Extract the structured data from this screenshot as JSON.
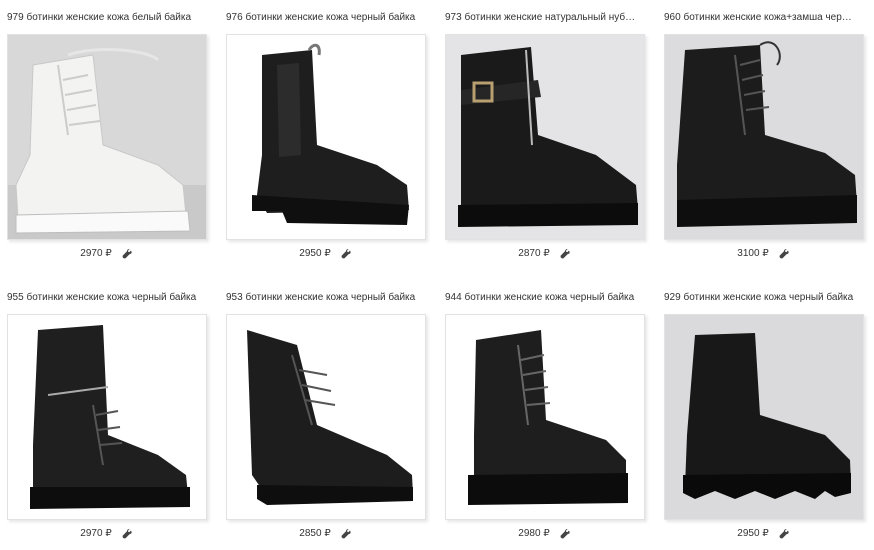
{
  "products": [
    {
      "title": "979 ботинки женские кожа белый байка",
      "price": "2970 ₽",
      "color": "#f1f1ef",
      "style": "white-lace"
    },
    {
      "title": "976 ботинки женские кожа черный байка",
      "price": "2950 ₽",
      "color": "#1a1a1a",
      "style": "chelsea"
    },
    {
      "title": "973 ботинки женские натуральный нуб…",
      "price": "2870 ₽",
      "color": "#151515",
      "style": "buckle"
    },
    {
      "title": "960 ботинки женские кожа+замша чер…",
      "price": "3100 ₽",
      "color": "#181818",
      "style": "lace-high"
    },
    {
      "title": "955 ботинки женские кожа черный байка",
      "price": "2970 ₽",
      "color": "#1c1c1c",
      "style": "zip-high"
    },
    {
      "title": "953 ботинки женские кожа черный байка",
      "price": "2850 ₽",
      "color": "#1b1b1b",
      "style": "lace-low"
    },
    {
      "title": "944 ботинки женские кожа черный байка",
      "price": "2980 ₽",
      "color": "#1a1a1a",
      "style": "platform-lace"
    },
    {
      "title": "929 ботинки женские кожа черный байка",
      "price": "2950 ₽",
      "color": "#141414",
      "style": "chunky-zip"
    }
  ],
  "edit_icon": "wrench-icon"
}
